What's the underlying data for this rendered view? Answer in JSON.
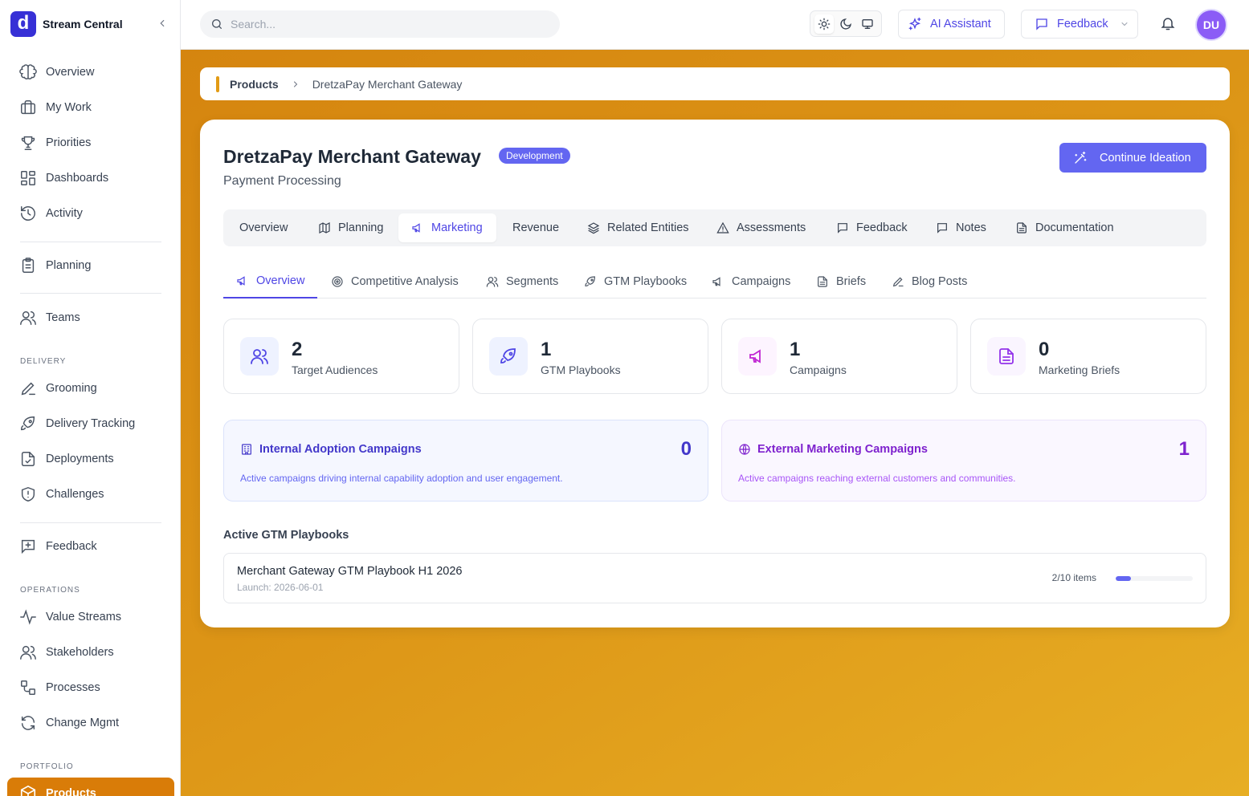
{
  "app": {
    "logo_letter": "d",
    "name": "Stream Central"
  },
  "sidebar": {
    "group1": [
      {
        "label": "Overview",
        "icon": "brain-icon"
      },
      {
        "label": "My Work",
        "icon": "briefcase-icon"
      },
      {
        "label": "Priorities",
        "icon": "trophy-icon"
      },
      {
        "label": "Dashboards",
        "icon": "dashboard-icon"
      },
      {
        "label": "Activity",
        "icon": "history-icon"
      }
    ],
    "planning": {
      "label": "Planning",
      "icon": "clipboard-icon"
    },
    "teams": {
      "label": "Teams",
      "icon": "users-icon"
    },
    "delivery_heading": "DELIVERY",
    "delivery": [
      {
        "label": "Grooming",
        "icon": "pencil-icon"
      },
      {
        "label": "Delivery Tracking",
        "icon": "rocket-icon"
      },
      {
        "label": "Deployments",
        "icon": "file-check-icon"
      },
      {
        "label": "Challenges",
        "icon": "shield-icon"
      }
    ],
    "feedback": {
      "label": "Feedback",
      "icon": "message-plus-icon"
    },
    "operations_heading": "OPERATIONS",
    "operations": [
      {
        "label": "Value Streams",
        "icon": "activity-icon"
      },
      {
        "label": "Stakeholders",
        "icon": "users-icon"
      },
      {
        "label": "Processes",
        "icon": "workflow-icon"
      },
      {
        "label": "Change Mgmt",
        "icon": "refresh-icon"
      }
    ],
    "portfolio_heading": "PORTFOLIO",
    "active": {
      "label": "Products",
      "icon": "package-icon"
    }
  },
  "topbar": {
    "search_placeholder": "Search...",
    "ai_label": "AI Assistant",
    "feedback_label": "Feedback",
    "avatar_initials": "DU"
  },
  "breadcrumb": {
    "root": "Products",
    "current": "DretzaPay Merchant Gateway"
  },
  "product": {
    "name": "DretzaPay Merchant Gateway",
    "status": "Development",
    "category": "Payment Processing",
    "cta_label": "Continue Ideation"
  },
  "tabs": [
    {
      "label": "Overview",
      "icon": ""
    },
    {
      "label": "Planning",
      "icon": "map-icon"
    },
    {
      "label": "Marketing",
      "icon": "megaphone-icon",
      "active": true
    },
    {
      "label": "Revenue",
      "icon": ""
    },
    {
      "label": "Related Entities",
      "icon": "layers-icon"
    },
    {
      "label": "Assessments",
      "icon": "warning-icon"
    },
    {
      "label": "Feedback",
      "icon": "message-icon"
    },
    {
      "label": "Notes",
      "icon": "note-icon"
    },
    {
      "label": "Documentation",
      "icon": "document-icon"
    }
  ],
  "subtabs": [
    {
      "label": "Overview",
      "icon": "megaphone-icon",
      "active": true
    },
    {
      "label": "Competitive Analysis",
      "icon": "target-icon"
    },
    {
      "label": "Segments",
      "icon": "users-icon"
    },
    {
      "label": "GTM Playbooks",
      "icon": "rocket-icon"
    },
    {
      "label": "Campaigns",
      "icon": "megaphone-icon"
    },
    {
      "label": "Briefs",
      "icon": "document-icon"
    },
    {
      "label": "Blog Posts",
      "icon": "pencil-icon"
    }
  ],
  "stats": [
    {
      "value": "2",
      "label": "Target Audiences",
      "icon": "users-icon",
      "color": "#4f46e5",
      "bg": "#eef2ff"
    },
    {
      "value": "1",
      "label": "GTM Playbooks",
      "icon": "rocket-icon",
      "color": "#4f46e5",
      "bg": "#eef2ff"
    },
    {
      "value": "1",
      "label": "Campaigns",
      "icon": "megaphone-icon",
      "color": "#c026d3",
      "bg": "#fdf4ff"
    },
    {
      "value": "0",
      "label": "Marketing Briefs",
      "icon": "document-icon",
      "color": "#9333ea",
      "bg": "#faf5ff"
    }
  ],
  "campaigns": {
    "internal": {
      "title": "Internal Adoption Campaigns",
      "count": "0",
      "description": "Active campaigns driving internal capability adoption and user engagement."
    },
    "external": {
      "title": "External Marketing Campaigns",
      "count": "1",
      "description": "Active campaigns reaching external customers and communities."
    }
  },
  "playbooks": {
    "heading": "Active GTM Playbooks",
    "items": [
      {
        "name": "Merchant Gateway GTM Playbook H1 2026",
        "launch": "Launch: 2026-06-01",
        "progress_text": "2/10 items",
        "progress": 0.2
      }
    ]
  },
  "colors": {
    "accent": "#6366f1",
    "sidebar_active": "#d97c08"
  }
}
